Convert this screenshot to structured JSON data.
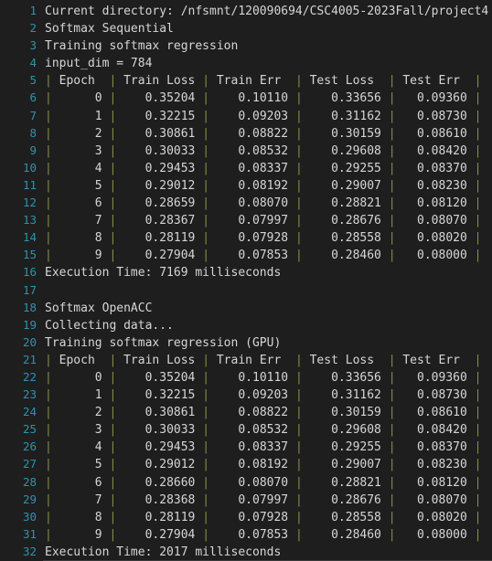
{
  "terminal": {
    "background_color": "#1e1e1e",
    "text_color": "#d4d4d4",
    "line_number_color": "#2d93ad",
    "pipe_color": "#8a8a4a",
    "total_lines": 32
  },
  "table": {
    "headers": [
      "Epoch",
      "Train Loss",
      "Train Err",
      "Test Loss",
      "Test Err"
    ]
  },
  "sections": {
    "header_lines": [
      "Current directory: /nfsmnt/120090694/CSC4005-2023Fall/project4",
      "Softmax Sequential",
      "Training softmax regression",
      "input_dim = 784"
    ],
    "sequential": {
      "title": "Softmax Sequential",
      "subtitle": "Training softmax regression",
      "input_dim_label": "input_dim = 784",
      "execution_time": "Execution Time: 7169 milliseconds",
      "rows": [
        {
          "epoch": "0",
          "train_loss": "0.35204",
          "train_err": "0.10110",
          "test_loss": "0.33656",
          "test_err": "0.09360"
        },
        {
          "epoch": "1",
          "train_loss": "0.32215",
          "train_err": "0.09203",
          "test_loss": "0.31162",
          "test_err": "0.08730"
        },
        {
          "epoch": "2",
          "train_loss": "0.30861",
          "train_err": "0.08822",
          "test_loss": "0.30159",
          "test_err": "0.08610"
        },
        {
          "epoch": "3",
          "train_loss": "0.30033",
          "train_err": "0.08532",
          "test_loss": "0.29608",
          "test_err": "0.08420"
        },
        {
          "epoch": "4",
          "train_loss": "0.29453",
          "train_err": "0.08337",
          "test_loss": "0.29255",
          "test_err": "0.08370"
        },
        {
          "epoch": "5",
          "train_loss": "0.29012",
          "train_err": "0.08192",
          "test_loss": "0.29007",
          "test_err": "0.08230"
        },
        {
          "epoch": "6",
          "train_loss": "0.28659",
          "train_err": "0.08070",
          "test_loss": "0.28821",
          "test_err": "0.08120"
        },
        {
          "epoch": "7",
          "train_loss": "0.28367",
          "train_err": "0.07997",
          "test_loss": "0.28676",
          "test_err": "0.08070"
        },
        {
          "epoch": "8",
          "train_loss": "0.28119",
          "train_err": "0.07928",
          "test_loss": "0.28558",
          "test_err": "0.08020"
        },
        {
          "epoch": "9",
          "train_loss": "0.27904",
          "train_err": "0.07853",
          "test_loss": "0.28460",
          "test_err": "0.08000"
        }
      ]
    },
    "openacc": {
      "title": "Softmax OpenACC",
      "collecting": "Collecting data...",
      "subtitle": "Training softmax regression (GPU)",
      "execution_time": "Execution Time: 2017 milliseconds",
      "rows": [
        {
          "epoch": "0",
          "train_loss": "0.35204",
          "train_err": "0.10110",
          "test_loss": "0.33656",
          "test_err": "0.09360"
        },
        {
          "epoch": "1",
          "train_loss": "0.32215",
          "train_err": "0.09203",
          "test_loss": "0.31162",
          "test_err": "0.08730"
        },
        {
          "epoch": "2",
          "train_loss": "0.30861",
          "train_err": "0.08822",
          "test_loss": "0.30159",
          "test_err": "0.08610"
        },
        {
          "epoch": "3",
          "train_loss": "0.30033",
          "train_err": "0.08532",
          "test_loss": "0.29608",
          "test_err": "0.08420"
        },
        {
          "epoch": "4",
          "train_loss": "0.29453",
          "train_err": "0.08337",
          "test_loss": "0.29255",
          "test_err": "0.08370"
        },
        {
          "epoch": "5",
          "train_loss": "0.29012",
          "train_err": "0.08192",
          "test_loss": "0.29007",
          "test_err": "0.08230"
        },
        {
          "epoch": "6",
          "train_loss": "0.28660",
          "train_err": "0.08070",
          "test_loss": "0.28821",
          "test_err": "0.08120"
        },
        {
          "epoch": "7",
          "train_loss": "0.28368",
          "train_err": "0.07997",
          "test_loss": "0.28676",
          "test_err": "0.08070"
        },
        {
          "epoch": "8",
          "train_loss": "0.28119",
          "train_err": "0.07928",
          "test_loss": "0.28558",
          "test_err": "0.08020"
        },
        {
          "epoch": "9",
          "train_loss": "0.27904",
          "train_err": "0.07853",
          "test_loss": "0.28460",
          "test_err": "0.08000"
        }
      ]
    }
  },
  "lines": [
    {
      "n": "1",
      "type": "text",
      "text": "Current directory: /nfsmnt/120090694/CSC4005-2023Fall/project4"
    },
    {
      "n": "2",
      "type": "text",
      "text": "Softmax Sequential"
    },
    {
      "n": "3",
      "type": "text",
      "text": "Training softmax regression"
    },
    {
      "n": "4",
      "type": "text",
      "text": "input_dim = 784"
    },
    {
      "n": "5",
      "type": "header",
      "cells": [
        "Epoch",
        "Train Loss",
        "Train Err",
        "Test Loss",
        "Test Err"
      ]
    },
    {
      "n": "6",
      "type": "data",
      "cells": [
        "0",
        "0.35204",
        "0.10110",
        "0.33656",
        "0.09360"
      ]
    },
    {
      "n": "7",
      "type": "data",
      "cells": [
        "1",
        "0.32215",
        "0.09203",
        "0.31162",
        "0.08730"
      ]
    },
    {
      "n": "8",
      "type": "data",
      "cells": [
        "2",
        "0.30861",
        "0.08822",
        "0.30159",
        "0.08610"
      ]
    },
    {
      "n": "9",
      "type": "data",
      "cells": [
        "3",
        "0.30033",
        "0.08532",
        "0.29608",
        "0.08420"
      ]
    },
    {
      "n": "10",
      "type": "data",
      "cells": [
        "4",
        "0.29453",
        "0.08337",
        "0.29255",
        "0.08370"
      ]
    },
    {
      "n": "11",
      "type": "data",
      "cells": [
        "5",
        "0.29012",
        "0.08192",
        "0.29007",
        "0.08230"
      ]
    },
    {
      "n": "12",
      "type": "data",
      "cells": [
        "6",
        "0.28659",
        "0.08070",
        "0.28821",
        "0.08120"
      ]
    },
    {
      "n": "13",
      "type": "data",
      "cells": [
        "7",
        "0.28367",
        "0.07997",
        "0.28676",
        "0.08070"
      ]
    },
    {
      "n": "14",
      "type": "data",
      "cells": [
        "8",
        "0.28119",
        "0.07928",
        "0.28558",
        "0.08020"
      ]
    },
    {
      "n": "15",
      "type": "data",
      "cells": [
        "9",
        "0.27904",
        "0.07853",
        "0.28460",
        "0.08000"
      ]
    },
    {
      "n": "16",
      "type": "text",
      "text": "Execution Time: 7169 milliseconds"
    },
    {
      "n": "17",
      "type": "text",
      "text": ""
    },
    {
      "n": "18",
      "type": "text",
      "text": "Softmax OpenACC"
    },
    {
      "n": "19",
      "type": "text",
      "text": "Collecting data..."
    },
    {
      "n": "20",
      "type": "text",
      "text": "Training softmax regression (GPU)"
    },
    {
      "n": "21",
      "type": "header",
      "cells": [
        "Epoch",
        "Train Loss",
        "Train Err",
        "Test Loss",
        "Test Err"
      ]
    },
    {
      "n": "22",
      "type": "data",
      "cells": [
        "0",
        "0.35204",
        "0.10110",
        "0.33656",
        "0.09360"
      ]
    },
    {
      "n": "23",
      "type": "data",
      "cells": [
        "1",
        "0.32215",
        "0.09203",
        "0.31162",
        "0.08730"
      ]
    },
    {
      "n": "24",
      "type": "data",
      "cells": [
        "2",
        "0.30861",
        "0.08822",
        "0.30159",
        "0.08610"
      ]
    },
    {
      "n": "25",
      "type": "data",
      "cells": [
        "3",
        "0.30033",
        "0.08532",
        "0.29608",
        "0.08420"
      ]
    },
    {
      "n": "26",
      "type": "data",
      "cells": [
        "4",
        "0.29453",
        "0.08337",
        "0.29255",
        "0.08370"
      ]
    },
    {
      "n": "27",
      "type": "data",
      "cells": [
        "5",
        "0.29012",
        "0.08192",
        "0.29007",
        "0.08230"
      ]
    },
    {
      "n": "28",
      "type": "data",
      "cells": [
        "6",
        "0.28660",
        "0.08070",
        "0.28821",
        "0.08120"
      ]
    },
    {
      "n": "29",
      "type": "data",
      "cells": [
        "7",
        "0.28368",
        "0.07997",
        "0.28676",
        "0.08070"
      ]
    },
    {
      "n": "30",
      "type": "data",
      "cells": [
        "8",
        "0.28119",
        "0.07928",
        "0.28558",
        "0.08020"
      ]
    },
    {
      "n": "31",
      "type": "data",
      "cells": [
        "9",
        "0.27904",
        "0.07853",
        "0.28460",
        "0.08000"
      ]
    },
    {
      "n": "32",
      "type": "text",
      "text": "Execution Time: 2017 milliseconds"
    }
  ]
}
